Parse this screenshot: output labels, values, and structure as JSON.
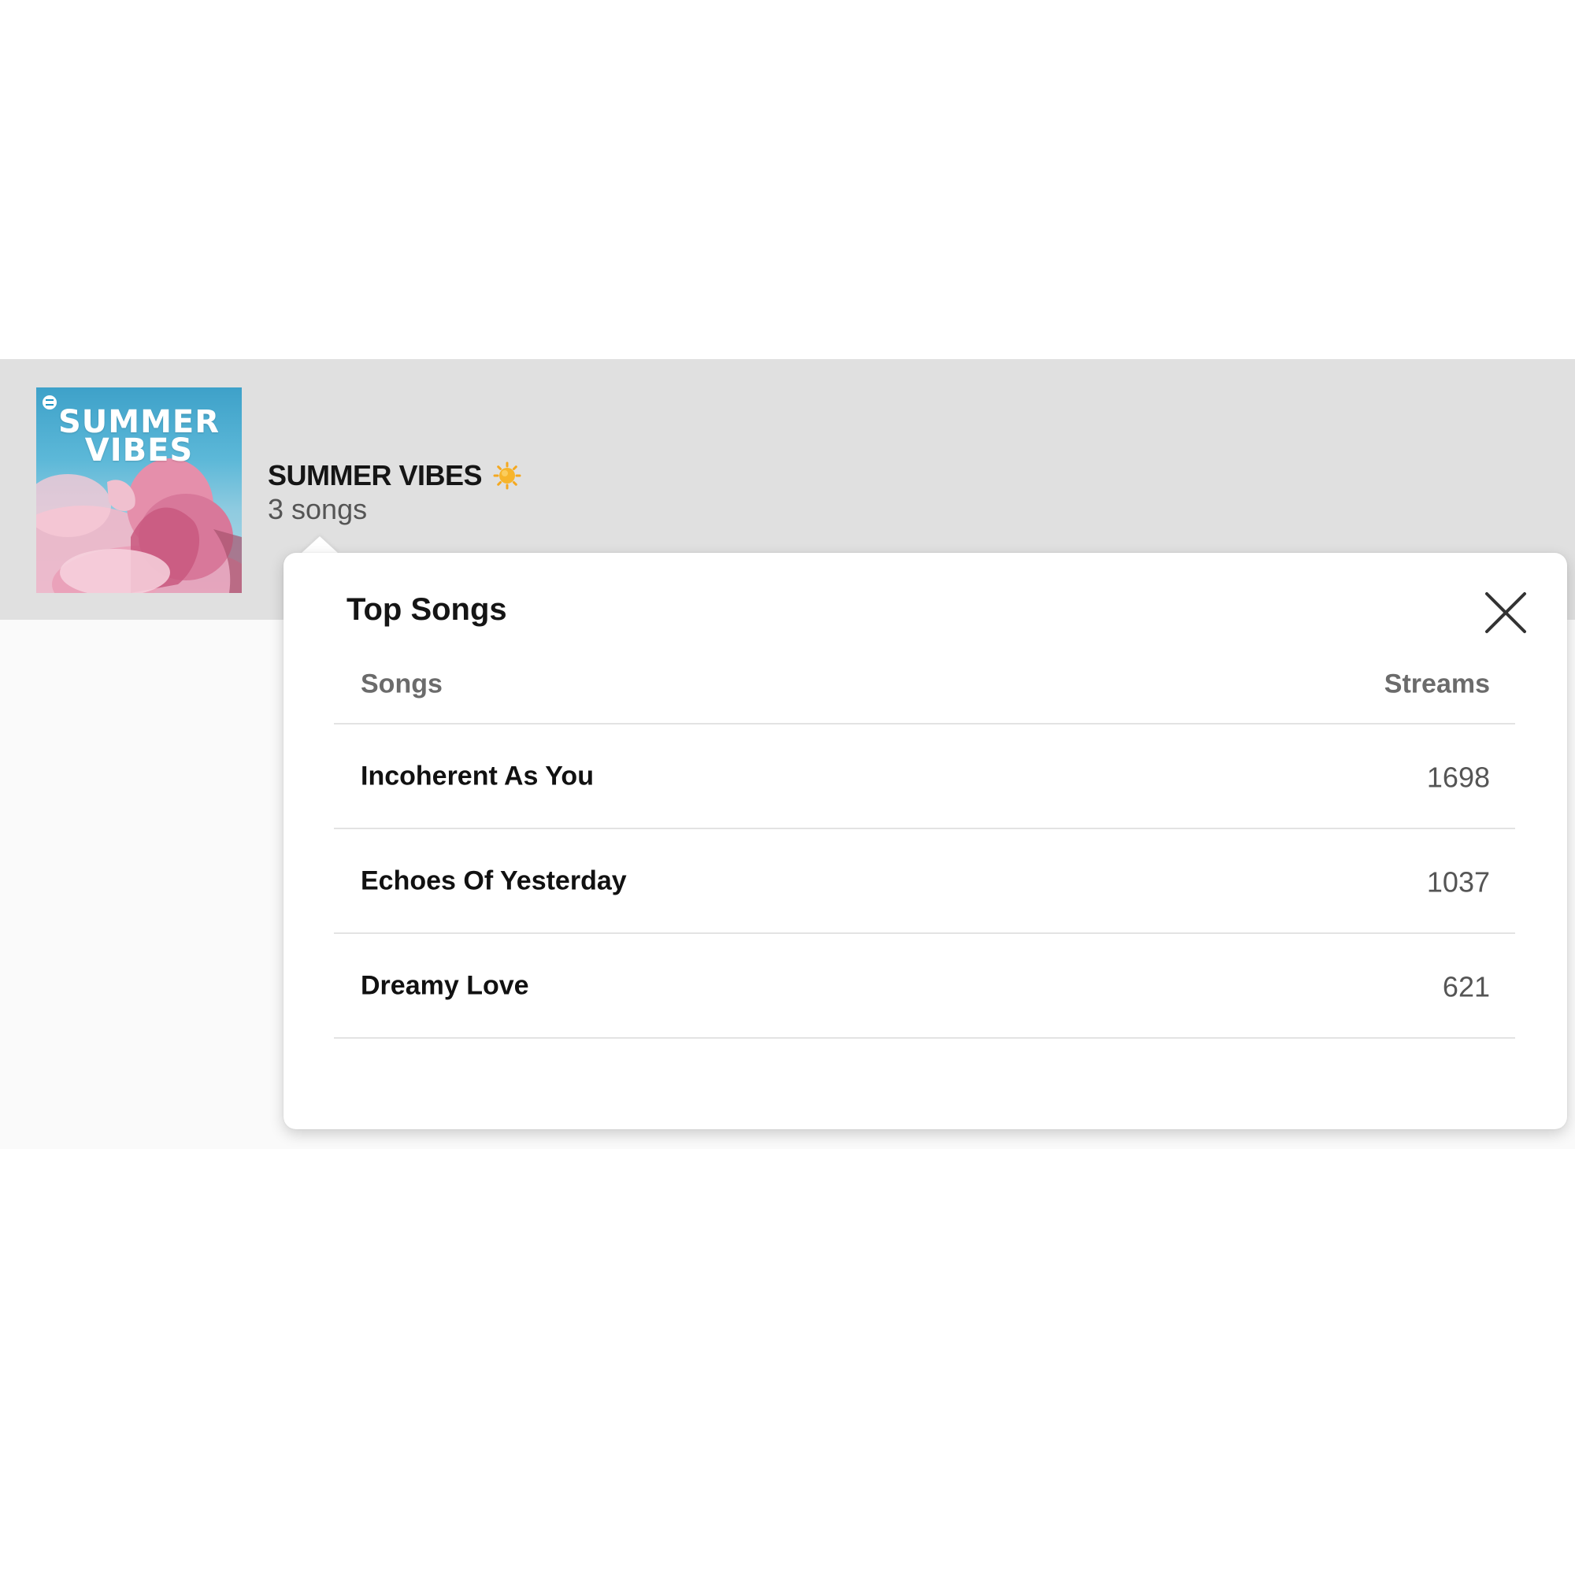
{
  "playlist": {
    "cover_title_line1": "SUMMER",
    "cover_title_line2": "VIBES",
    "title": "SUMMER VIBES",
    "title_icon": "sun-icon",
    "song_count": "3 songs"
  },
  "popover": {
    "title": "Top Songs",
    "close_icon": "close-icon",
    "columns": [
      "Songs",
      "Streams"
    ],
    "rows": [
      {
        "song": "Incoherent As You",
        "streams": "1698"
      },
      {
        "song": "Echoes Of Yesterday",
        "streams": "1037"
      },
      {
        "song": "Dreamy Love",
        "streams": "621"
      }
    ]
  },
  "colors": {
    "header_band": "#e0e0e0",
    "text_primary": "#151515",
    "text_secondary": "#555555",
    "sun": "#f4a820"
  }
}
